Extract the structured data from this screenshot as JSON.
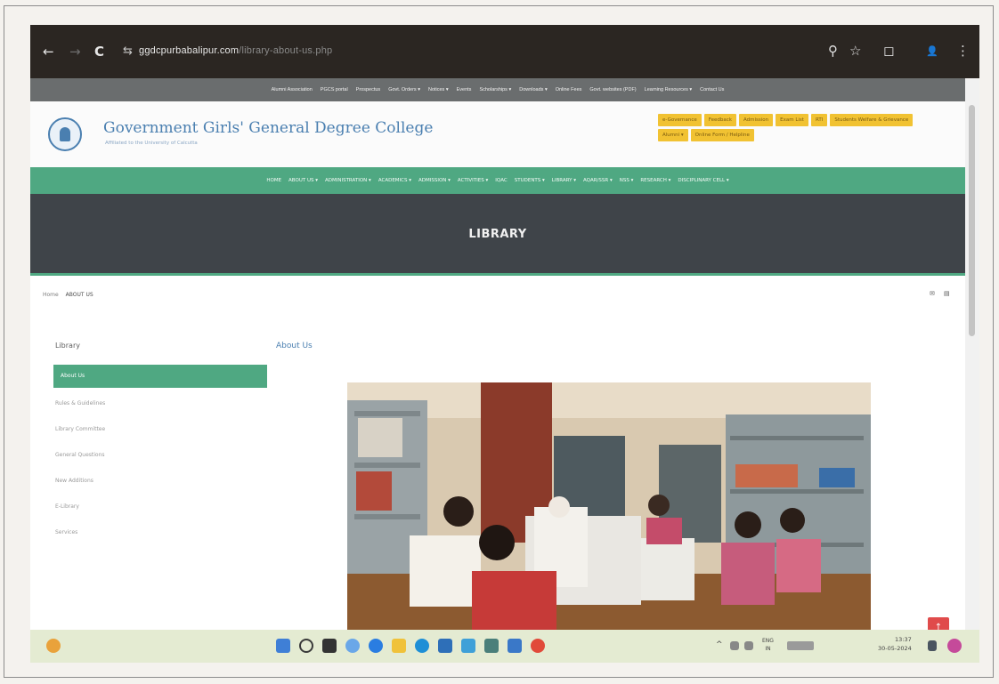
{
  "browser": {
    "back": "←",
    "forward": "→",
    "reload": "C",
    "site_info": "⇆",
    "url_host": "ggdcpurbabalipur.com",
    "url_path": "/library-about-us.php",
    "search_icon": "⚲",
    "star_icon": "☆",
    "ext_icon": "◻",
    "profile_icon": "👤",
    "menu_icon": "⋮"
  },
  "topbar": {
    "items": [
      "Alumni Association",
      "PGCS portal",
      "Prospectus",
      "Govt. Orders ▾",
      "Notices ▾",
      "Events",
      "Scholarships ▾",
      "Downloads ▾",
      "Online Fees",
      "Govt. websites (PDF)",
      "Learning Resources ▾",
      "Contact Us"
    ]
  },
  "header": {
    "college_name": "Government Girls' General Degree College",
    "subtitle": "Affiliated to the University of Calcutta",
    "buttons": [
      "e-Governance",
      "Feedback",
      "Admission",
      "Exam List",
      "RTI",
      "Students Welfare & Grievance",
      "Alumni ▾",
      "Online Form / Helpline"
    ]
  },
  "mainnav": {
    "items": [
      "HOME",
      "ABOUT US ▾",
      "ADMINISTRATION ▾",
      "ACADEMICS ▾",
      "ADMISSION ▾",
      "ACTIVITIES ▾",
      "IQAC",
      "STUDENTS ▾",
      "LIBRARY ▾",
      "AQAR/SSR ▾",
      "NSS ▾",
      "RESEARCH ▾",
      "DISCIPLINARY CELL ▾"
    ]
  },
  "banner": {
    "title": "LIBRARY"
  },
  "breadcrumb": {
    "home": "Home",
    "current": "ABOUT US"
  },
  "share": {
    "icon_a": "✉",
    "icon_b": "▤"
  },
  "sidebar": {
    "heading": "Library",
    "active": "About Us",
    "items": [
      "Rules & Guidelines",
      "Library Committee",
      "General Questions",
      "New Additions",
      "E-Library",
      "Services"
    ]
  },
  "main": {
    "heading": "About Us"
  },
  "scroll_top": {
    "icon": "↑"
  },
  "taskbar": {
    "lang": "ENG",
    "lang2": "IN",
    "time": "13:37",
    "date": "30-05-2024",
    "tray_caret": "^"
  },
  "colors": {
    "green_accent": "#4fa882",
    "blue_title": "#4a7fb0",
    "yellow_button": "#f1c232",
    "banner_dark": "#3f4449"
  }
}
